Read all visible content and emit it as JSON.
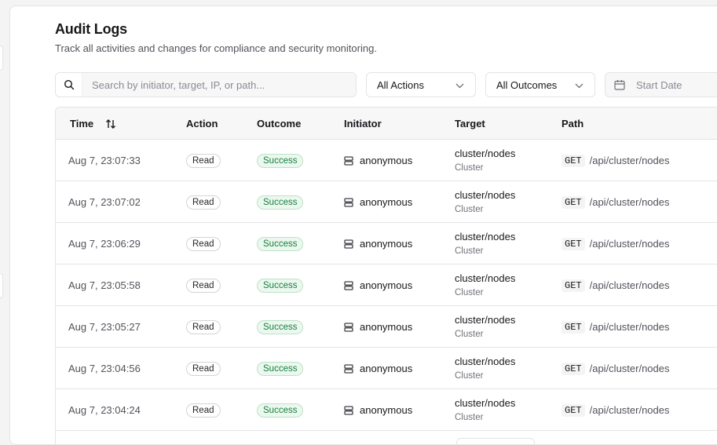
{
  "header": {
    "title": "Audit Logs",
    "subtitle": "Track all activities and changes for compliance and security monitoring."
  },
  "filters": {
    "search_placeholder": "Search by initiator, target, IP, or path...",
    "actions_label": "All Actions",
    "outcomes_label": "All Outcomes",
    "date_placeholder": "Start Date"
  },
  "table": {
    "columns": {
      "time": "Time",
      "action": "Action",
      "outcome": "Outcome",
      "initiator": "Initiator",
      "target": "Target",
      "path": "Path"
    },
    "rows": [
      {
        "time": "Aug 7, 23:07:33",
        "action": "Read",
        "outcome": "Success",
        "initiator": "anonymous",
        "target": "cluster/nodes",
        "target_type": "Cluster",
        "method": "GET",
        "path": "/api/cluster/nodes"
      },
      {
        "time": "Aug 7, 23:07:02",
        "action": "Read",
        "outcome": "Success",
        "initiator": "anonymous",
        "target": "cluster/nodes",
        "target_type": "Cluster",
        "method": "GET",
        "path": "/api/cluster/nodes"
      },
      {
        "time": "Aug 7, 23:06:29",
        "action": "Read",
        "outcome": "Success",
        "initiator": "anonymous",
        "target": "cluster/nodes",
        "target_type": "Cluster",
        "method": "GET",
        "path": "/api/cluster/nodes"
      },
      {
        "time": "Aug 7, 23:05:58",
        "action": "Read",
        "outcome": "Success",
        "initiator": "anonymous",
        "target": "cluster/nodes",
        "target_type": "Cluster",
        "method": "GET",
        "path": "/api/cluster/nodes"
      },
      {
        "time": "Aug 7, 23:05:27",
        "action": "Read",
        "outcome": "Success",
        "initiator": "anonymous",
        "target": "cluster/nodes",
        "target_type": "Cluster",
        "method": "GET",
        "path": "/api/cluster/nodes"
      },
      {
        "time": "Aug 7, 23:04:56",
        "action": "Read",
        "outcome": "Success",
        "initiator": "anonymous",
        "target": "cluster/nodes",
        "target_type": "Cluster",
        "method": "GET",
        "path": "/api/cluster/nodes"
      },
      {
        "time": "Aug 7, 23:04:24",
        "action": "Read",
        "outcome": "Success",
        "initiator": "anonymous",
        "target": "cluster/nodes",
        "target_type": "Cluster",
        "method": "GET",
        "path": "/api/cluster/nodes"
      }
    ]
  },
  "colors": {
    "success_bg": "#ecf8ef",
    "success_text": "#15803d",
    "border": "#e4e4e7"
  },
  "icons": {
    "search": "search-icon",
    "sort": "sort-arrows-icon",
    "chevron": "chevron-down-icon",
    "calendar": "calendar-icon",
    "initiator": "server-icon"
  }
}
